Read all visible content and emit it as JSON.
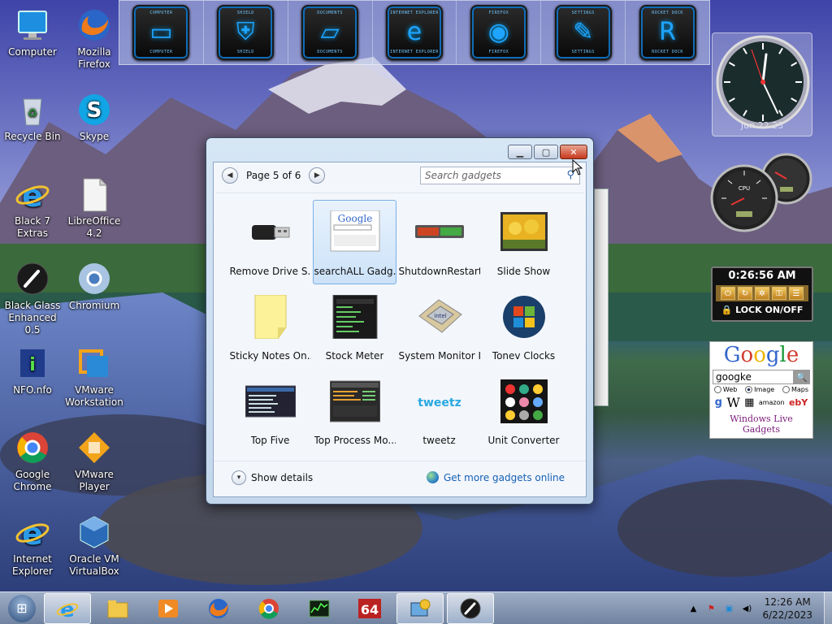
{
  "desktop_icons": [
    {
      "label": "Computer",
      "icon": "computer-icon"
    },
    {
      "label": "Mozilla Firefox",
      "icon": "firefox-icon"
    },
    {
      "label": "Recycle Bin",
      "icon": "recycle-bin-icon"
    },
    {
      "label": "Skype",
      "icon": "skype-icon"
    },
    {
      "label": "Black 7 Extras",
      "icon": "ie-icon"
    },
    {
      "label": "LibreOffice 4.2",
      "icon": "libreoffice-icon"
    },
    {
      "label": "Black Glass Enhanced 0.5",
      "icon": "black-glass-icon"
    },
    {
      "label": "Chromium",
      "icon": "chromium-icon"
    },
    {
      "label": "NFO.nfo",
      "icon": "nfo-icon"
    },
    {
      "label": "VMware Workstation",
      "icon": "vmware-workstation-icon"
    },
    {
      "label": "Google Chrome",
      "icon": "chrome-icon"
    },
    {
      "label": "VMware Player",
      "icon": "vmware-player-icon"
    },
    {
      "label": "Internet Explorer",
      "icon": "ie-icon"
    },
    {
      "label": "Oracle VM VirtualBox",
      "icon": "virtualbox-icon"
    }
  ],
  "dock": [
    {
      "caption": "COMPUTER",
      "icon": "monitor-icon"
    },
    {
      "caption": "SHIELD",
      "icon": "shield-icon"
    },
    {
      "caption": "DOCUMENTS",
      "icon": "folder-icon"
    },
    {
      "caption": "INTERNET EXPLORER",
      "icon": "ie-icon"
    },
    {
      "caption": "FIREFOX",
      "icon": "firefox-icon"
    },
    {
      "caption": "SETTINGS",
      "icon": "wrench-icon"
    },
    {
      "caption": "ROCKET DOCK",
      "icon": "rocketdock-icon"
    }
  ],
  "gadget_window": {
    "page_text": "Page 5 of 6",
    "search_placeholder": "Search gadgets",
    "items": [
      {
        "name": "Remove Drive S...",
        "selected": false
      },
      {
        "name": "searchALL Gadg...",
        "selected": true
      },
      {
        "name": "ShutdownRestart",
        "selected": false
      },
      {
        "name": "Slide Show",
        "selected": false
      },
      {
        "name": "Sticky Notes On...",
        "selected": false
      },
      {
        "name": "Stock Meter",
        "selected": false
      },
      {
        "name": "System Monitor II",
        "selected": false
      },
      {
        "name": "Tonev Clocks",
        "selected": false
      },
      {
        "name": "Top Five",
        "selected": false
      },
      {
        "name": "Top Process Mo...",
        "selected": false
      },
      {
        "name": "tweetz",
        "selected": false
      },
      {
        "name": "Unit Converter",
        "selected": false
      }
    ],
    "show_details": "Show details",
    "get_more": "Get more gadgets online"
  },
  "clock_gadget": {
    "label": "Jun 22 23"
  },
  "lock_gadget": {
    "time": "0:26:56 AM",
    "label": "LOCK ON/OFF"
  },
  "google_gadget": {
    "logo": "Google",
    "query": "googke",
    "options": [
      "Web",
      "Image",
      "Maps"
    ],
    "selected_option": "Image",
    "sources": [
      "Google",
      "W",
      "amazon",
      "ebY"
    ],
    "footer": "Windows Live Gadgets"
  },
  "taskbar": {
    "pinned": [
      "ie-icon",
      "explorer-icon",
      "media-player-icon",
      "firefox-icon",
      "chrome-icon",
      "monitor-graph-icon",
      "64-icon",
      "gadgets-icon",
      "black-glass-icon"
    ],
    "time": "12:26 AM",
    "date": "6/22/2023"
  },
  "colors": {
    "accent": "#1fa4ff",
    "close": "#c7381d",
    "link": "#1560b6"
  }
}
